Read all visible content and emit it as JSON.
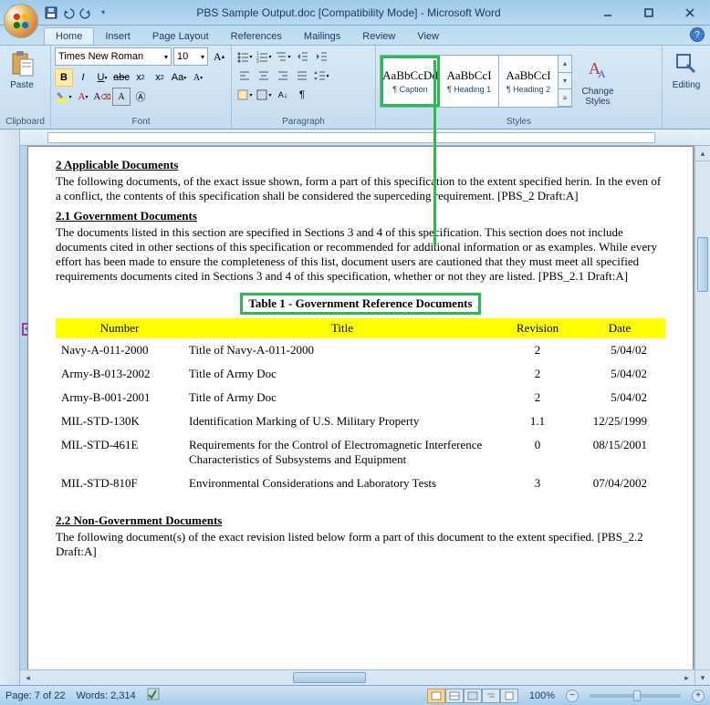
{
  "titlebar": {
    "title": "PBS Sample Output.doc [Compatibility Mode] - Microsoft Word"
  },
  "tabs": [
    "Home",
    "Insert",
    "Page Layout",
    "References",
    "Mailings",
    "Review",
    "View"
  ],
  "active_tab": 0,
  "ribbon": {
    "clipboard": {
      "label": "Clipboard",
      "paste": "Paste"
    },
    "font": {
      "label": "Font",
      "name": "Times New Roman",
      "size": "10"
    },
    "paragraph": {
      "label": "Paragraph"
    },
    "styles": {
      "label": "Styles",
      "items": [
        {
          "preview": "AaBbCcDd",
          "name": "¶ Caption",
          "selected": true
        },
        {
          "preview": "AaBbCcI",
          "name": "¶ Heading 1",
          "selected": false
        },
        {
          "preview": "AaBbCcI",
          "name": "¶ Heading 2",
          "selected": false
        }
      ],
      "change": "Change Styles"
    },
    "editing": {
      "label": "Editing"
    }
  },
  "document": {
    "h2": "2  Applicable Documents",
    "p2": "The following documents, of the exact issue shown, form a part of this specification to the extent specified herin. In the even of a conflict, the contents of this specification shall be considered the superceding requirement. [PBS_2 Draft:A]",
    "h21": "2.1  Government Documents",
    "p21": "The documents listed in this section are specified in Sections 3 and 4 of this specification.  This section does not include documents cited in other sections of this specification or recommended for additional information or as examples.  While every effort has been made to ensure the completeness of this list, document users are cautioned that they must meet all specified requirements documents cited in Sections 3 and 4 of this specification, whether or not they are listed. [PBS_2.1 Draft:A]",
    "caption": "Table 1 - Government Reference Documents",
    "headers": [
      "Number",
      "Title",
      "Revision",
      "Date"
    ],
    "rows": [
      {
        "num": "Navy-A-011-2000",
        "title": "Title of Navy-A-011-2000",
        "rev": "2",
        "date": "5/04/02"
      },
      {
        "num": "Army-B-013-2002",
        "title": "Title of Army Doc",
        "rev": "2",
        "date": "5/04/02"
      },
      {
        "num": "Army-B-001-2001",
        "title": "Title of Army Doc",
        "rev": "2",
        "date": "5/04/02"
      },
      {
        "num": "MIL-STD-130K",
        "title": "Identification Marking of U.S. Military Property",
        "rev": "1.1",
        "date": "12/25/1999"
      },
      {
        "num": "MIL-STD-461E",
        "title": "Requirements for the Control of Electromagnetic Interference Characteristics of Subsystems and Equipment",
        "rev": "0",
        "date": "08/15/2001"
      },
      {
        "num": "MIL-STD-810F",
        "title": "Environmental Considerations and Laboratory Tests",
        "rev": "3",
        "date": "07/04/2002"
      }
    ],
    "h22": "2.2  Non-Government Documents",
    "p22": "The following document(s) of the exact revision listed below form a part of this document to the extent specified. [PBS_2.2 Draft:A]"
  },
  "statusbar": {
    "page": "Page: 7 of 22",
    "words": "Words: 2,314",
    "zoom": "100%"
  }
}
